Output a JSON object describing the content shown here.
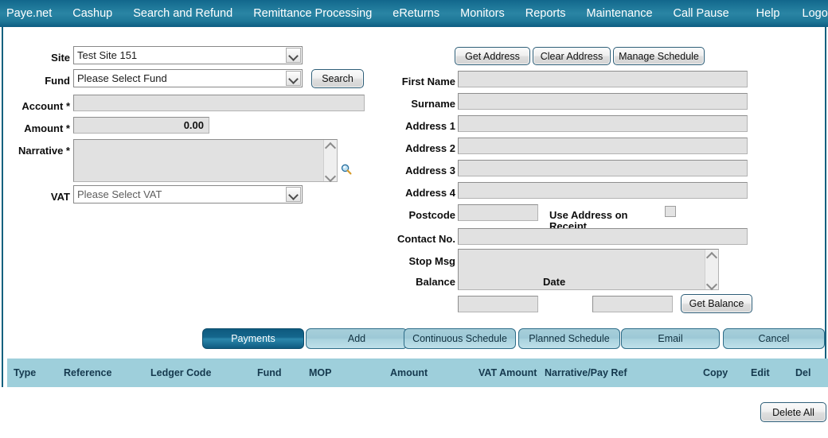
{
  "nav": {
    "left_items": [
      {
        "label": "Paye.net",
        "name": "nav-payenet"
      },
      {
        "label": "Cashup",
        "name": "nav-cashup"
      },
      {
        "label": "Search and Refund",
        "name": "nav-search-and-refund"
      },
      {
        "label": "Remittance Processing",
        "name": "nav-remittance-processing"
      },
      {
        "label": "eReturns",
        "name": "nav-ereturns"
      },
      {
        "label": "Monitors",
        "name": "nav-monitors"
      },
      {
        "label": "Reports",
        "name": "nav-reports"
      },
      {
        "label": "Maintenance",
        "name": "nav-maintenance"
      },
      {
        "label": "Call Pause",
        "name": "nav-call-pause"
      }
    ],
    "right_items": [
      {
        "label": "Help",
        "name": "nav-help"
      },
      {
        "label": "Logout",
        "name": "nav-logout"
      }
    ]
  },
  "left_form": {
    "site": {
      "label": "Site",
      "value": "Test Site 151"
    },
    "fund": {
      "label": "Fund",
      "value": "Please Select Fund"
    },
    "account": {
      "label": "Account *",
      "value": ""
    },
    "amount": {
      "label": "Amount *",
      "value": "0.00"
    },
    "narrative": {
      "label": "Narrative *",
      "value": ""
    },
    "vat": {
      "label": "VAT",
      "value": "Please Select VAT"
    },
    "search_button": "Search"
  },
  "right_form": {
    "buttons": {
      "get_address": "Get Address",
      "clear_address": "Clear Address",
      "manage_schedule": "Manage Schedule",
      "get_balance": "Get Balance"
    },
    "fields": [
      {
        "label": "First Name",
        "value": ""
      },
      {
        "label": "Surname",
        "value": ""
      },
      {
        "label": "Address 1",
        "value": ""
      },
      {
        "label": "Address 2",
        "value": ""
      },
      {
        "label": "Address 3",
        "value": ""
      },
      {
        "label": "Address 4",
        "value": ""
      }
    ],
    "postcode": {
      "label": "Postcode",
      "value": ""
    },
    "use_address_on_receipt": {
      "label": "Use Address on Receipt",
      "checked": false
    },
    "contact_no": {
      "label": "Contact No.",
      "value": ""
    },
    "stop_msg": {
      "label": "Stop Msg",
      "value": ""
    },
    "balance": {
      "label": "Balance",
      "value": ""
    },
    "date": {
      "label": "Date",
      "value": ""
    }
  },
  "action_bar": [
    {
      "label": "Payments",
      "active": true
    },
    {
      "label": "Add",
      "active": false
    },
    {
      "label": "Continuous Schedule",
      "active": false
    },
    {
      "label": "Planned Schedule",
      "active": false
    },
    {
      "label": "Email",
      "active": false
    },
    {
      "label": "Cancel",
      "active": false
    }
  ],
  "table": {
    "columns": [
      "Type",
      "Reference",
      "Ledger Code",
      "Fund",
      "MOP",
      "Amount",
      "VAT Amount",
      "Narrative/Pay Ref",
      "Copy",
      "Edit",
      "Del"
    ],
    "rows": []
  },
  "footer": {
    "delete_all": "Delete All"
  },
  "colors": {
    "navbar": "#1c7597",
    "frame_border": "#15617f",
    "table_header": "#9ecfdb",
    "active_tab": "#14668c",
    "tab": "#a8cfda",
    "field_bg": "#e1e1e1"
  }
}
